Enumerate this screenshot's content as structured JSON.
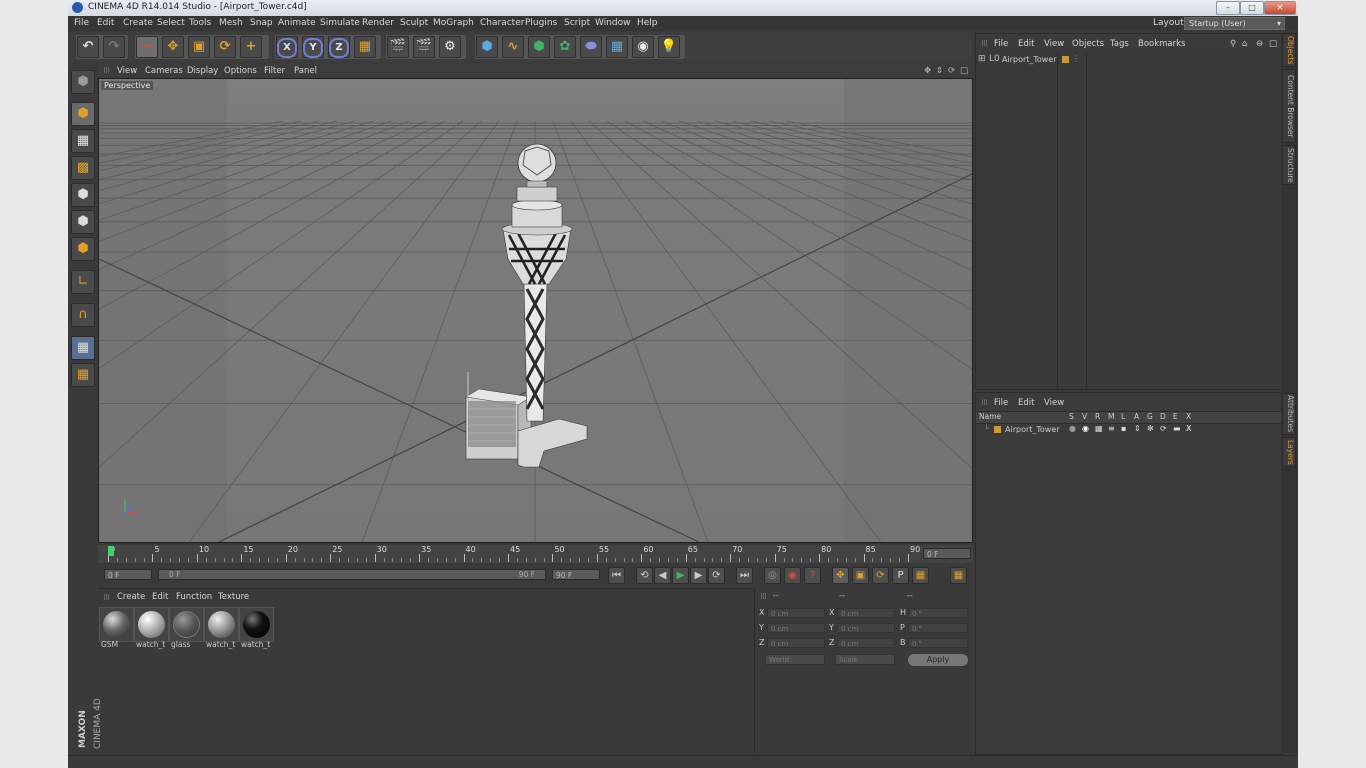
{
  "window": {
    "title": "CINEMA 4D R14.014 Studio - [Airport_Tower.c4d]",
    "min_icon": "minimize-icon",
    "max_icon": "maximize-icon",
    "close_icon": "close-icon"
  },
  "menubar": {
    "items": [
      "File",
      "Edit",
      "Create",
      "Select",
      "Tools",
      "Mesh",
      "Snap",
      "Animate",
      "Simulate",
      "Render",
      "Sculpt",
      "MoGraph",
      "Character",
      "Plugins",
      "Script",
      "Window",
      "Help"
    ],
    "layout_label": "Layout:",
    "layout_value": "Startup (User)"
  },
  "toolbar": {
    "axis_x": "X",
    "axis_y": "Y",
    "axis_z": "Z"
  },
  "viewport": {
    "menu": [
      "View",
      "Cameras",
      "Display",
      "Options",
      "Filter",
      "Panel"
    ],
    "camera_label": "Perspective"
  },
  "timeline": {
    "ticks": [
      "0",
      "5",
      "10",
      "15",
      "20",
      "25",
      "30",
      "35",
      "40",
      "45",
      "50",
      "55",
      "60",
      "65",
      "70",
      "75",
      "80",
      "85",
      "90"
    ],
    "current_frame": "0 F"
  },
  "transport": {
    "start_field": "0 F",
    "range_start": "0 F",
    "range_end": "90 F",
    "end_field": "90 F"
  },
  "materials": {
    "menu": [
      "Create",
      "Edit",
      "Function",
      "Texture"
    ],
    "items": [
      {
        "label": "GSM"
      },
      {
        "label": "watch_t"
      },
      {
        "label": "glass"
      },
      {
        "label": "watch_t"
      },
      {
        "label": "watch_t"
      }
    ]
  },
  "coordinates": {
    "header_a": "--",
    "header_b": "--",
    "header_c": "--",
    "rows": [
      {
        "a_label": "X",
        "a_val": "0 cm",
        "b_label": "X",
        "b_val": "0 cm",
        "c_label": "H",
        "c_val": "0 °"
      },
      {
        "a_label": "Y",
        "a_val": "0 cm",
        "b_label": "Y",
        "b_val": "0 cm",
        "c_label": "P",
        "c_val": "0 °"
      },
      {
        "a_label": "Z",
        "a_val": "0 cm",
        "b_label": "Z",
        "b_val": "0 cm",
        "c_label": "B",
        "c_val": "0 °"
      }
    ],
    "world": "World",
    "scale": "Scale",
    "apply": "Apply"
  },
  "objects": {
    "menu": [
      "File",
      "Edit",
      "View",
      "Objects",
      "Tags",
      "Bookmarks"
    ],
    "tree": [
      {
        "name": "Airport_Tower"
      }
    ]
  },
  "layers": {
    "menu": [
      "File",
      "Edit",
      "View"
    ],
    "headers": [
      "Name",
      "S",
      "V",
      "R",
      "M",
      "L",
      "A",
      "G",
      "D",
      "E",
      "X"
    ],
    "rows": [
      {
        "name": "Airport_Tower"
      }
    ]
  },
  "side_tabs": [
    "Objects",
    "Content Browser",
    "Structure",
    "Attributes",
    "Layers"
  ],
  "branding": {
    "maxon": "MAXON",
    "cinema": "CINEMA 4D"
  }
}
